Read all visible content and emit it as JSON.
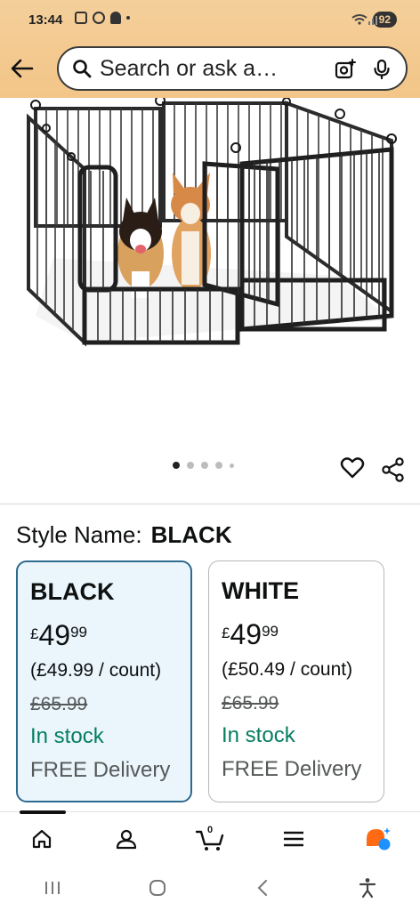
{
  "status_bar": {
    "time": "13:44",
    "battery": "92",
    "icons": [
      "screenshot-icon",
      "vpn-icon",
      "snapchat-icon",
      "notification-dot"
    ]
  },
  "header": {
    "search_placeholder": "Search or ask a…",
    "icons": [
      "back-arrow-icon",
      "search-icon",
      "camera-lens-icon",
      "microphone-icon"
    ]
  },
  "gallery": {
    "image_count": 5,
    "active_index": 0
  },
  "style": {
    "label": "Style Name:",
    "value": "BLACK"
  },
  "options": [
    {
      "name": "BLACK",
      "currency": "£",
      "whole": "49",
      "fraction": "99",
      "unit_price": "(£49.99 / count)",
      "was_price": "£65.99",
      "stock": "In stock",
      "delivery": "FREE Delivery",
      "selected": true
    },
    {
      "name": "WHITE",
      "currency": "£",
      "whole": "49",
      "fraction": "99",
      "unit_price": "(£50.49 / count)",
      "was_price": "£65.99",
      "stock": "In stock",
      "delivery": "FREE Delivery",
      "selected": false
    }
  ],
  "bottom_nav": {
    "cart_count": "0",
    "items": [
      "home-icon",
      "account-icon",
      "cart-icon",
      "menu-icon",
      "rufus-icon"
    ]
  },
  "colors": {
    "header_bg": "#f4cf9a",
    "selected_border": "#2e6a8f",
    "selected_bg": "#eaf6fc",
    "in_stock": "#067d62",
    "rufus_orange": "#ff6a13",
    "rufus_blue": "#1e90ff"
  }
}
